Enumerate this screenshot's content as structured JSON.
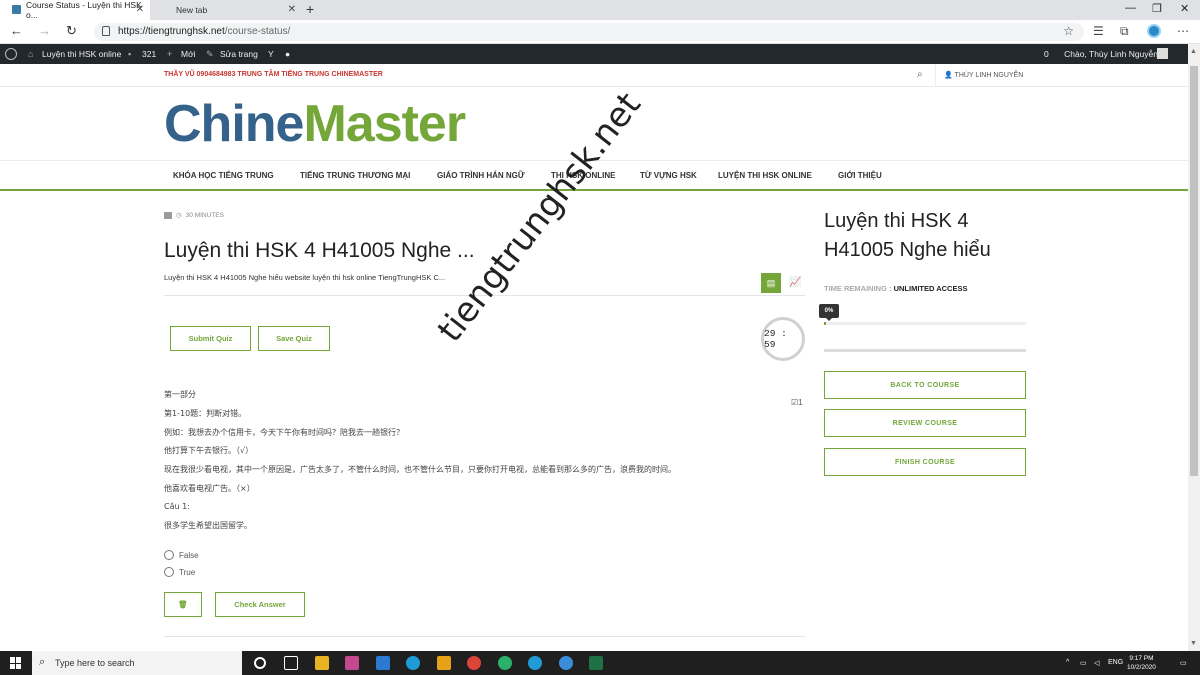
{
  "browser": {
    "tabs": [
      {
        "label": "Course Status - Luyện thi HSK o..."
      },
      {
        "label": "New tab"
      }
    ],
    "url_host": "https://tiengtrunghsk.net",
    "url_path": "/course-status/"
  },
  "wpbar": {
    "site": "Luyện thi HSK online",
    "comments": "321",
    "new": "Mới",
    "edit": "Sửa trang",
    "notif": "0",
    "greeting": "Chào, Thùy Linh Nguyễn"
  },
  "topstrip": {
    "hotline": "THẦY VŨ 0904684983 TRUNG TÂM TIẾNG TRUNG CHINEMASTER",
    "user": "THÙY LINH NGUYỄN"
  },
  "logo": {
    "part1": "Chine",
    "part2": "Master"
  },
  "nav": [
    "KHÓA HỌC TIẾNG TRUNG",
    "TIẾNG TRUNG THƯƠNG MẠI",
    "GIÁO TRÌNH HÁN NGỮ",
    "THI HSK ONLINE",
    "TỪ VỰNG HSK",
    "LUYỆN THI HSK ONLINE",
    "GIỚI THIỆU"
  ],
  "quiz": {
    "duration": "30 MINUTES",
    "title": "Luyện thi HSK 4 H41005 Nghe ...",
    "subtitle": "Luyện thi HSK 4 H41005 Nghe hiểu website luyện thi hsk online TiengTrungHSK C...",
    "submit_label": "Submit Quiz",
    "save_label": "Save Quiz",
    "timer": "29 : 59",
    "checked_count": "1",
    "lines": [
      "第一部分",
      "第1-10题：判断对错。",
      "例如：我想去办个信用卡，今天下午你有时间吗？陪我去一趟银行？",
      "他打算下午去银行。（√）",
      "现在我很少看电视，其中一个原因是，广告太多了，不管什么时间，也不管什么节目，只要你打开电视，总能看到那么多的广告，浪费我的时间。",
      "他喜欢看电视广告。（×）",
      "Câu 1:",
      "很多学生希望出国留学。"
    ],
    "options": [
      "False",
      "True"
    ],
    "check_label": "Check Answer"
  },
  "sidebar": {
    "title": "Luyện thi HSK 4 H41005 Nghe hiểu",
    "time_label": "TIME REMAINING :",
    "time_value": "UNLIMITED ACCESS",
    "progress_label": "0%",
    "progress": 0.01,
    "back": "BACK TO COURSE",
    "review": "REVIEW COURSE",
    "finish": "FINISH COURSE"
  },
  "watermark": "tiengtrunghsk.net",
  "taskbar": {
    "search_placeholder": "Type here to search",
    "lang": "ENG",
    "time": "9:17 PM",
    "date": "10/2/2020"
  },
  "colors": {
    "accent": "#74a63a",
    "brand_blue": "#34628a",
    "wpbar": "#23282d"
  }
}
